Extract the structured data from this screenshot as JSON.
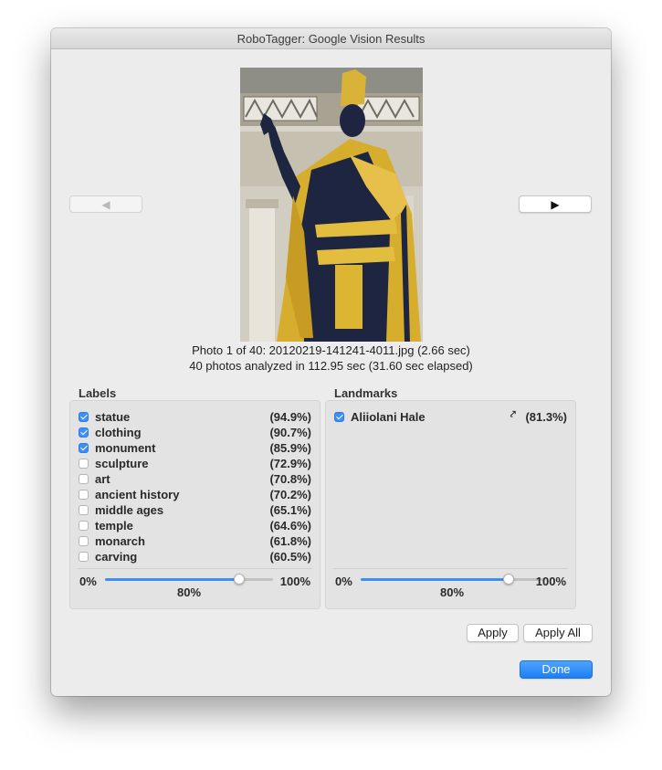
{
  "window": {
    "title": "RoboTagger: Google Vision Results"
  },
  "nav": {
    "prev_icon": "triangle-left-icon",
    "prev_glyph": "◀",
    "next_icon": "triangle-right-icon",
    "next_glyph": "▶"
  },
  "photo": {
    "description_icon": "statue-photo"
  },
  "info": {
    "line1": "Photo 1 of 40: 20120219-141241-4011.jpg (2.66 sec)",
    "line2": "40 photos analyzed in 112.95 sec (31.60 sec elapsed)"
  },
  "labels": {
    "title": "Labels",
    "items": [
      {
        "name": "statue",
        "pct": "(94.9%)",
        "checked": true
      },
      {
        "name": "clothing",
        "pct": "(90.7%)",
        "checked": true
      },
      {
        "name": "monument",
        "pct": "(85.9%)",
        "checked": true
      },
      {
        "name": "sculpture",
        "pct": "(72.9%)",
        "checked": false
      },
      {
        "name": "art",
        "pct": "(70.8%)",
        "checked": false
      },
      {
        "name": "ancient history",
        "pct": "(70.2%)",
        "checked": false
      },
      {
        "name": "middle ages",
        "pct": "(65.1%)",
        "checked": false
      },
      {
        "name": "temple",
        "pct": "(64.6%)",
        "checked": false
      },
      {
        "name": "monarch",
        "pct": "(61.8%)",
        "checked": false
      },
      {
        "name": "carving",
        "pct": "(60.5%)",
        "checked": false
      }
    ],
    "slider": {
      "min_label": "0%",
      "max_label": "100%",
      "value_label": "80%",
      "value": 0.8
    }
  },
  "landmarks": {
    "title": "Landmarks",
    "items": [
      {
        "name": "Aliiolani Hale",
        "pct": "(81.3%)",
        "checked": true,
        "icon": "location-pin-icon",
        "glyph": "⤤"
      }
    ],
    "slider": {
      "min_label": "0%",
      "max_label": "100%",
      "value_label": "80%",
      "value": 0.8
    }
  },
  "buttons": {
    "apply": "Apply",
    "apply_all": "Apply All",
    "done": "Done"
  },
  "colors": {
    "accent": "#3d8ef7",
    "window_bg": "#ececec",
    "panel_bg": "#e3e3e3"
  }
}
